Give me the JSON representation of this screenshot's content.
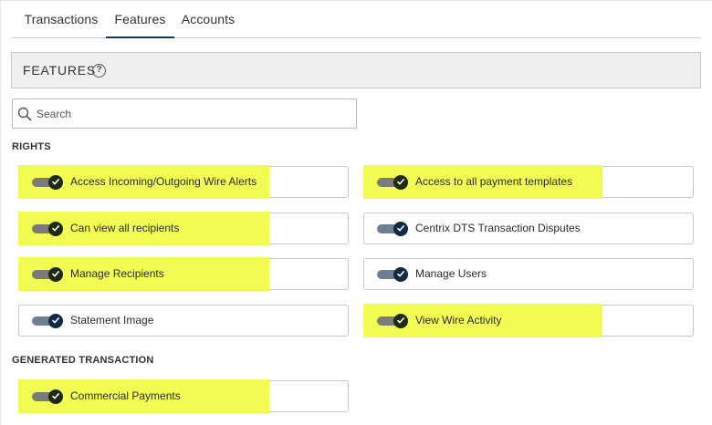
{
  "tabs": [
    {
      "label": "Transactions",
      "active": false
    },
    {
      "label": "Features",
      "active": true
    },
    {
      "label": "Accounts",
      "active": false
    }
  ],
  "features_header": {
    "title": "FEATURES",
    "help_icon": "question-circle-icon"
  },
  "search": {
    "placeholder": "Search",
    "value": "",
    "icon": "search-icon"
  },
  "sections": {
    "rights": {
      "label": "RIGHTS",
      "items": [
        {
          "label": "Access Incoming/Outgoing Wire Alerts",
          "enabled": true,
          "highlighted": true
        },
        {
          "label": "Access to all payment templates",
          "enabled": true,
          "highlighted": true
        },
        {
          "label": "Can view all recipients",
          "enabled": true,
          "highlighted": true
        },
        {
          "label": "Centrix DTS Transaction Disputes",
          "enabled": true,
          "highlighted": false
        },
        {
          "label": "Manage Recipients",
          "enabled": true,
          "highlighted": true
        },
        {
          "label": "Manage Users",
          "enabled": true,
          "highlighted": false
        },
        {
          "label": "Statement Image",
          "enabled": true,
          "highlighted": false
        },
        {
          "label": "View Wire Activity",
          "enabled": true,
          "highlighted": true
        }
      ]
    },
    "generated": {
      "label": "GENERATED TRANSACTION",
      "items": [
        {
          "label": "Commercial Payments",
          "enabled": true,
          "highlighted": true
        }
      ]
    }
  },
  "colors": {
    "highlight": "#f2fb52",
    "toggle_knob": "#0f2a44",
    "active_tab_underline": "#0f3b5f",
    "header_bg": "#efefef"
  }
}
